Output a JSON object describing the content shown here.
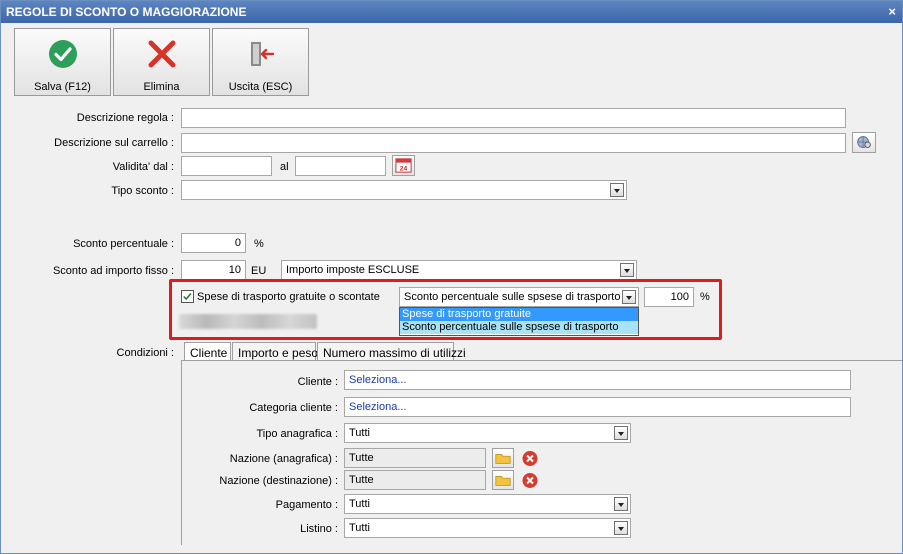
{
  "window": {
    "title": "REGOLE DI SCONTO O MAGGIORAZIONE",
    "close_glyph": "×"
  },
  "toolbar": {
    "save_label": "Salva (F12)",
    "delete_label": "Elimina",
    "exit_label": "Uscita (ESC)"
  },
  "form": {
    "descrizione_regola_label": "Descrizione regola :",
    "descrizione_regola_value": "",
    "descrizione_carrello_label": "Descrizione sul carrello :",
    "descrizione_carrello_value": "",
    "validita_label": "Validita' dal :",
    "validita_dal_value": "",
    "al_label": "al",
    "validita_al_value": "",
    "calendar_day": "24",
    "tipo_sconto_label": "Tipo sconto :",
    "tipo_sconto_value": "",
    "sconto_percentuale_label": "Sconto percentuale :",
    "sconto_percentuale_value": "0",
    "percent_unit": "%",
    "sconto_importo_label": "Sconto ad importo fisso :",
    "sconto_importo_value": "10",
    "eu_unit": "EU",
    "importo_imposte_value": "Importo imposte ESCLUSE"
  },
  "shipping": {
    "checkbox_label": "Spese di trasporto gratuite o scontate",
    "checked": true,
    "type_value": "Sconto percentuale sulle spsese di trasporto",
    "percent_value": "100",
    "percent_unit": "%",
    "options": [
      "Spese di trasporto gratuite",
      "Sconto percentuale sulle spsese di trasporto"
    ]
  },
  "conditions": {
    "label": "Condizioni :",
    "tabs": [
      {
        "label": "Cliente"
      },
      {
        "label": "Importo e peso"
      },
      {
        "label": "Numero massimo di utilizzi"
      }
    ],
    "cliente_label": "Cliente :",
    "cliente_value": "Seleziona...",
    "categoria_label": "Categoria cliente :",
    "categoria_value": "Seleziona...",
    "tipo_anagrafica_label": "Tipo anagrafica :",
    "tipo_anagrafica_value": "Tutti",
    "nazione_anagrafica_label": "Nazione (anagrafica) :",
    "nazione_anagrafica_value": "Tutte",
    "nazione_destinazione_label": "Nazione (destinazione) :",
    "nazione_destinazione_value": "Tutte",
    "pagamento_label": "Pagamento :",
    "pagamento_value": "Tutti",
    "listino_label": "Listino :",
    "listino_value": "Tutti"
  },
  "colors": {
    "title_bar": "#3d66a8",
    "highlight_border": "#e01b1b",
    "selected_option": "#3399ff",
    "hover_option": "#a8e3f5",
    "save_icon": "#2e9e5b",
    "delete_icon": "#d6342a"
  }
}
